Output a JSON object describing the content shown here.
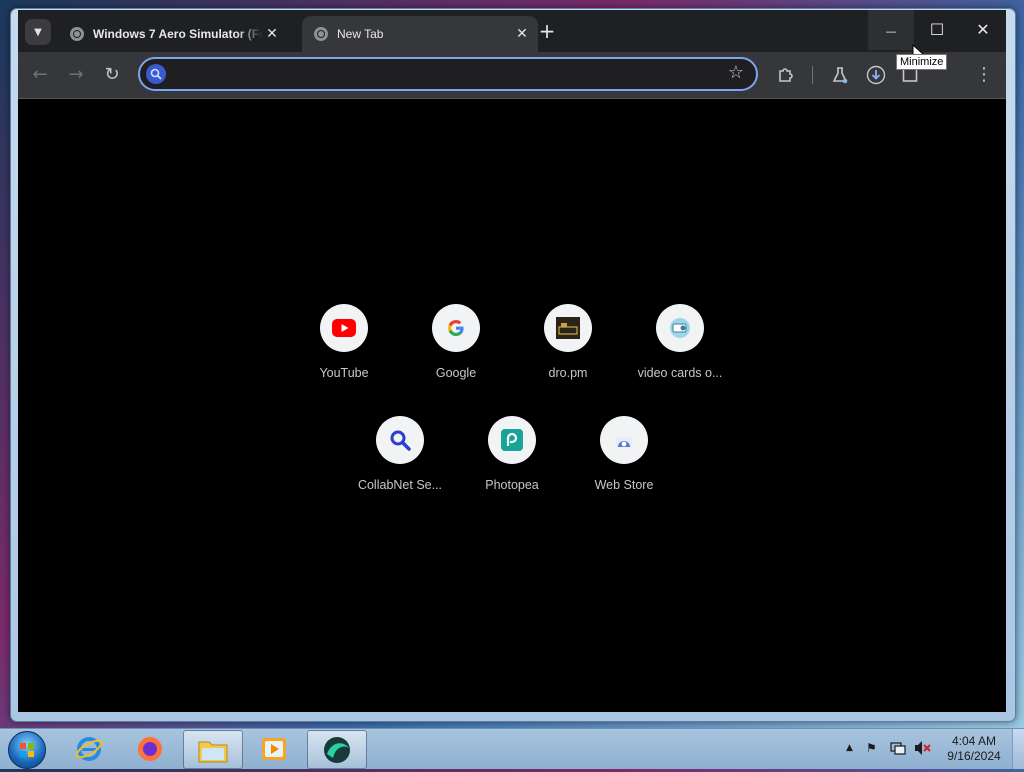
{
  "browser": {
    "tabs": [
      {
        "title": "Windows 7 Aero Simulator (Fo",
        "active": false
      },
      {
        "title": "New Tab",
        "active": true
      }
    ],
    "tab_close_glyph": "✕",
    "new_tab_glyph": "+",
    "window_controls": {
      "minimize": "—",
      "maximize": "☐",
      "close": "✕"
    },
    "toolbar": {
      "back_icon": "←",
      "forward_icon": "→",
      "reload_icon": "↻",
      "bookmark_icon": "☆",
      "menu_icon": "⋮"
    },
    "omnibox": {
      "value": "",
      "placeholder": ""
    },
    "tooltip": "Minimize"
  },
  "ntp": {
    "shortcuts_row1": [
      {
        "label": "YouTube",
        "icon": "youtube-icon"
      },
      {
        "label": "Google",
        "icon": "google-icon"
      },
      {
        "label": "dro.pm",
        "icon": "dro-pm-icon"
      },
      {
        "label": "video cards o...",
        "icon": "video-cards-icon"
      }
    ],
    "shortcuts_row2": [
      {
        "label": "CollabNet Se...",
        "icon": "collabnet-icon"
      },
      {
        "label": "Photopea",
        "icon": "photopea-icon"
      },
      {
        "label": "Web Store",
        "icon": "web-store-icon"
      }
    ]
  },
  "taskbar": {
    "apps": [
      "internet-explorer-icon",
      "firefox-icon",
      "file-explorer-icon",
      "media-player-icon",
      "browser-icon"
    ],
    "tray": {
      "up_arrow": "▲",
      "flag": "⚑"
    },
    "clock": {
      "time": "4:04 AM",
      "date": "9/16/2024"
    }
  },
  "colors": {
    "accent": "#7ca4f4",
    "tab_bg": "#36373b",
    "toolbar_bg": "#36373b",
    "page_bg": "#000000"
  }
}
